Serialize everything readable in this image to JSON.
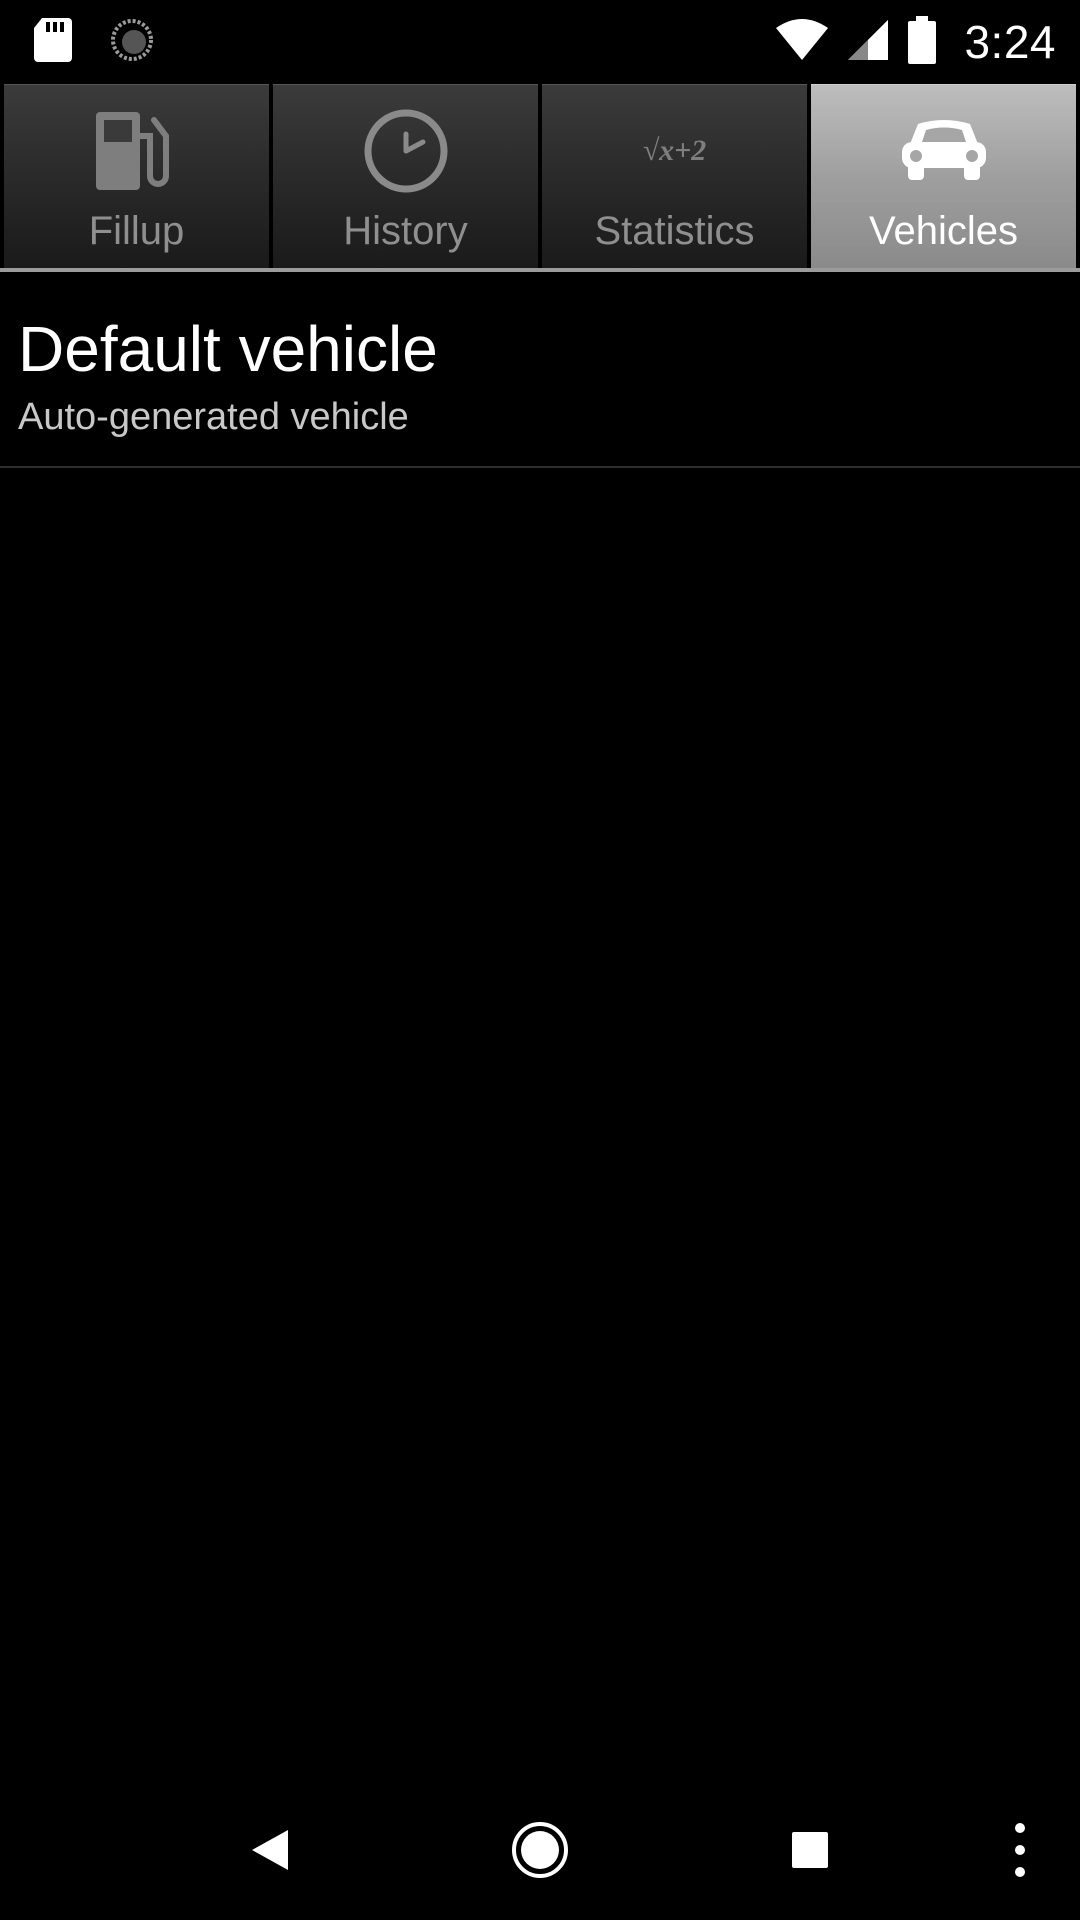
{
  "status_bar": {
    "time": "3:24",
    "icons": [
      "sd-card-icon",
      "sync-icon",
      "wifi-icon",
      "signal-icon",
      "battery-icon"
    ]
  },
  "tabs": [
    {
      "label": "Fillup",
      "icon": "fuel-pump-icon",
      "active": false
    },
    {
      "label": "History",
      "icon": "clock-icon",
      "active": false
    },
    {
      "label": "Statistics",
      "icon": "formula-icon",
      "icon_text": "√x+2",
      "active": false
    },
    {
      "label": "Vehicles",
      "icon": "car-icon",
      "active": true
    }
  ],
  "vehicles": [
    {
      "name": "Default vehicle",
      "description": "Auto-generated vehicle"
    }
  ],
  "nav_bar": {
    "buttons": [
      "back-icon",
      "home-icon",
      "recents-icon",
      "overflow-menu-icon"
    ]
  },
  "colors": {
    "background": "#000000",
    "tab_active": "#a6a6a6",
    "tab_inactive": "#2a2a2a",
    "tab_label_inactive": "#8f8f8f",
    "text_primary": "#ffffff",
    "text_secondary": "#c8c8c8"
  }
}
